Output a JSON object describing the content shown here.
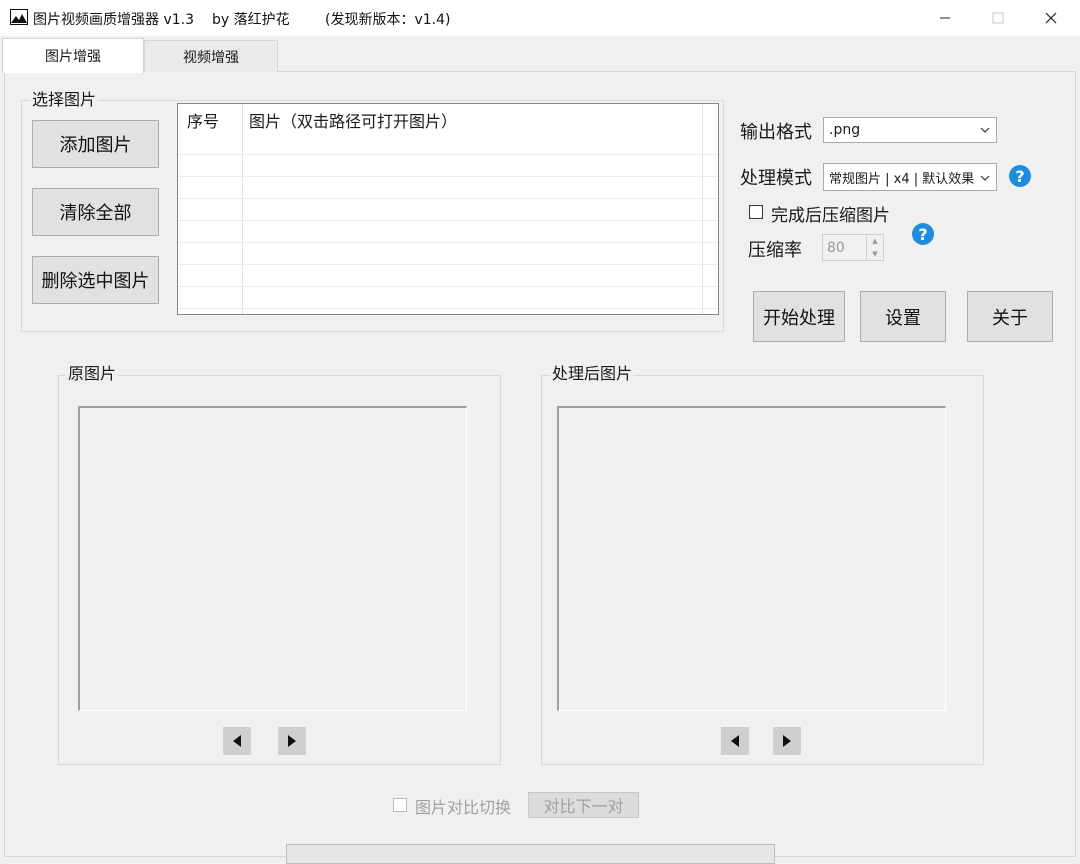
{
  "window": {
    "title": "图片视频画质增强器 v1.3",
    "author": "by 落红护花",
    "update_notice": "(发现新版本：v1.4)"
  },
  "tabs": [
    {
      "label": "图片增强",
      "active": true
    },
    {
      "label": "视频增强",
      "active": false
    }
  ],
  "select_group": {
    "label": "选择图片",
    "add_button": "添加图片",
    "clear_button": "清除全部",
    "delete_button": "删除选中图片"
  },
  "list": {
    "columns": [
      "序号",
      "图片（双击路径可打开图片）"
    ],
    "rows": []
  },
  "options": {
    "output_format_label": "输出格式",
    "output_format_value": ".png",
    "mode_label": "处理模式",
    "mode_value": "常规图片 | x4 | 默认效果",
    "compress_checkbox_label": "完成后压缩图片",
    "compress_checked": false,
    "compress_rate_label": "压缩率",
    "compress_rate_value": "80",
    "help_icon_glyph": "?"
  },
  "actions": {
    "start_button": "开始处理",
    "settings_button": "设置",
    "about_button": "关于"
  },
  "preview": {
    "original_label": "原图片",
    "processed_label": "处理后图片"
  },
  "compare": {
    "toggle_label": "图片对比切换",
    "toggle_checked": false,
    "next_pair_button": "对比下一对"
  },
  "colors": {
    "help_icon": "#1e8de0",
    "window_bg": "#f0f0f0"
  }
}
